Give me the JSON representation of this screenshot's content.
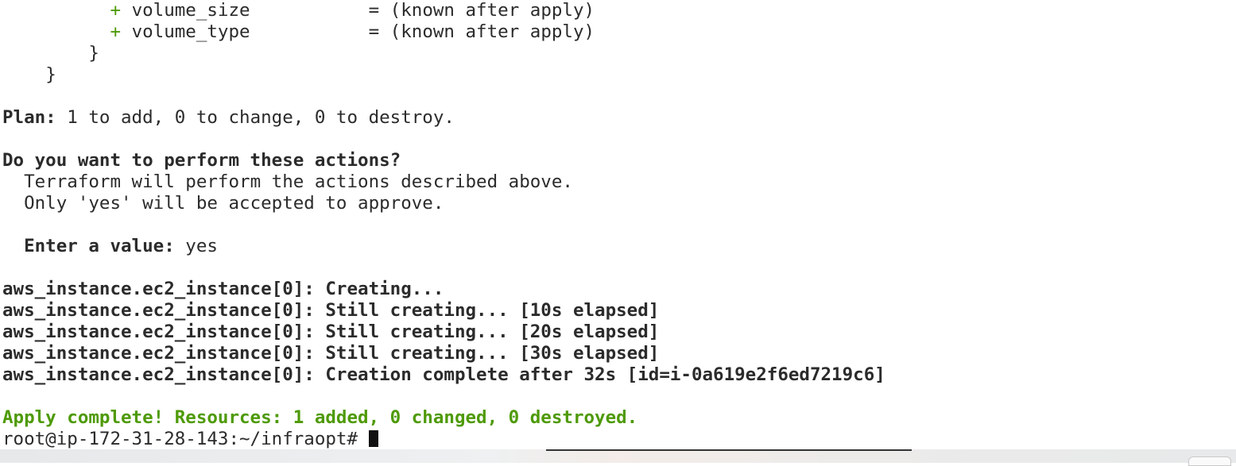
{
  "terminal": {
    "lines": {
      "l1_plus": "+",
      "l1_key": "volume_size",
      "l1_val": "= (known after apply)",
      "l2_plus": "+",
      "l2_key": "volume_type",
      "l2_val": "= (known after apply)",
      "l3": "}",
      "l4": "}",
      "plan_label": "Plan:",
      "plan_text": "1 to add, 0 to change, 0 to destroy.",
      "question": "Do you want to perform these actions?",
      "info1": "Terraform will perform the actions described above.",
      "info2": "Only 'yes' will be accepted to approve.",
      "enter_label": "Enter a value:",
      "enter_value": "yes",
      "create1": "aws_instance.ec2_instance[0]: Creating...",
      "create2": "aws_instance.ec2_instance[0]: Still creating... [10s elapsed]",
      "create3": "aws_instance.ec2_instance[0]: Still creating... [20s elapsed]",
      "create4": "aws_instance.ec2_instance[0]: Still creating... [30s elapsed]",
      "create5": "aws_instance.ec2_instance[0]: Creation complete after 32s [id=i-0a619e2f6ed7219c6]",
      "apply": "Apply complete! Resources: 1 added, 0 changed, 0 destroyed.",
      "prompt": "root@ip-172-31-28-143:~/infraopt#"
    }
  },
  "colors": {
    "success": "#4e9a06",
    "text": "#2b2b2b",
    "background": "#ffffff"
  }
}
